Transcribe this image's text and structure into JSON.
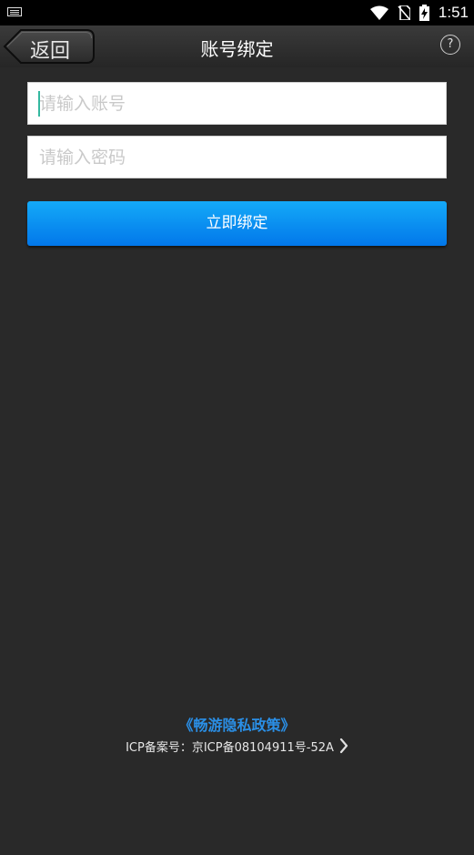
{
  "status_bar": {
    "time": "1:51",
    "icons": [
      "keyboard-icon",
      "wifi-icon",
      "no-sim-icon",
      "battery-charging-icon"
    ]
  },
  "header": {
    "back_label": "返回",
    "title": "账号绑定",
    "help_label": "?"
  },
  "form": {
    "account_placeholder": "请输入账号",
    "account_value": "",
    "password_placeholder": "请输入密码",
    "password_value": "",
    "submit_label": "立即绑定"
  },
  "footer": {
    "privacy_link": "《畅游隐私政策》",
    "icp_text": "ICP备案号：京ICP备08104911号-52A",
    "icp_arrow_icon": "chevron-right-icon"
  },
  "colors": {
    "background": "#292929",
    "button_blue": "#0a8ff2",
    "link_blue": "#2a8fe6"
  }
}
